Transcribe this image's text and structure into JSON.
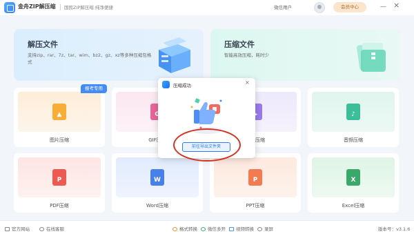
{
  "titlebar": {
    "app_name": "金舟ZIP解压缩",
    "tagline": "国民ZIP解压缩  纯净便捷",
    "user_name": "微信用户",
    "vip_label": "会员中心",
    "minimize": "—",
    "close": "×"
  },
  "banners": [
    {
      "title": "解压文件",
      "desc": "支持zip、rar、7z、tar、wim、bz2、gz、xz等多种压缩包格式"
    },
    {
      "title": "压缩文件",
      "desc": "智能高效压缩，耗时少"
    }
  ],
  "badge": "报考专用",
  "cards": [
    {
      "label": "图片压缩"
    },
    {
      "label": "GIF压缩"
    },
    {
      "label": "视频压缩"
    },
    {
      "label": "音频压缩"
    },
    {
      "label": "PDF压缩",
      "glyph": "P"
    },
    {
      "label": "Word压缩",
      "glyph": "W"
    },
    {
      "label": "PPT压缩",
      "glyph": "P"
    },
    {
      "label": "Excel压缩",
      "glyph": "X"
    }
  ],
  "statusbar": {
    "website": "官方网站",
    "support": "在线客服",
    "format_convert": "格式转换",
    "wechat_multi": "微信多开",
    "video_convert": "视频转换",
    "recorder": "录屏",
    "version": "版本号：v3.1.6"
  },
  "dialog": {
    "title": "压缩成功",
    "close": "×",
    "button": "前往导出文件夹"
  },
  "colors": {
    "accent": "#2b7cf6",
    "highlight_circle": "#d23222"
  }
}
